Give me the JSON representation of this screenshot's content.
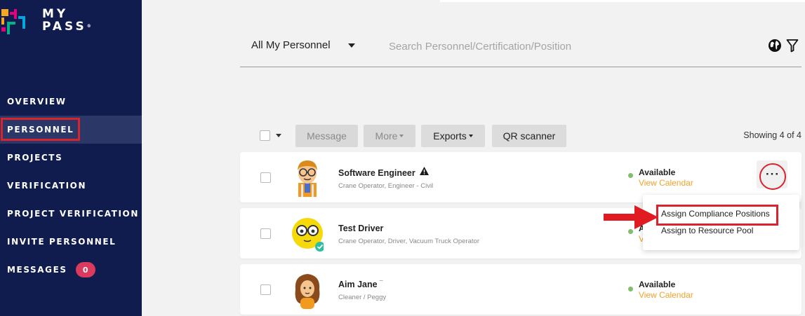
{
  "app": {
    "logo_text_line1": "MY",
    "logo_text_line2": "PASS",
    "trademark": "®"
  },
  "sidebar": {
    "items": [
      {
        "label": "OVERVIEW"
      },
      {
        "label": "PERSONNEL",
        "active": true
      },
      {
        "label": "PROJECTS"
      },
      {
        "label": "VERIFICATION"
      },
      {
        "label": "PROJECT VERIFICATION"
      },
      {
        "label": "INVITE PERSONNEL"
      },
      {
        "label": "MESSAGES",
        "badge": "0"
      }
    ]
  },
  "filter": {
    "scope_label": "All My Personnel",
    "search_placeholder": "Search Personnel/Certification/Position",
    "search_value": ""
  },
  "toolbar": {
    "message_label": "Message",
    "more_label": "More",
    "exports_label": "Exports",
    "qr_label": "QR scanner",
    "showing_text": "Showing 4 of 4"
  },
  "personnel": [
    {
      "name": "Software Engineer",
      "positions": "Crane Operator, Engineer - Civil",
      "status": "Available",
      "calendar_link": "View Calendar",
      "warning": true,
      "avatar": "engineer-avatar"
    },
    {
      "name": "Test Driver",
      "positions": "Crane Operator, Driver, Vacuum Truck Operator",
      "status": "A",
      "calendar_link": "V",
      "verified": true,
      "avatar": "glasses-face-avatar"
    },
    {
      "name": "Aim Jane",
      "name_suffix": "¯",
      "positions": "Cleaner / Peggy",
      "status": "Available",
      "calendar_link": "View Calendar",
      "avatar": "woman-avatar"
    }
  ],
  "row_menu": {
    "items": [
      {
        "label": "Assign Compliance Positions"
      },
      {
        "label": "Assign to Resource Pool"
      }
    ]
  },
  "colors": {
    "sidebar_bg": "#0f1c4d",
    "highlight_red": "#d9232d",
    "link_orange": "#f0a32a",
    "available_green": "#7fbf6a",
    "badge_pink": "#d93a5e"
  }
}
